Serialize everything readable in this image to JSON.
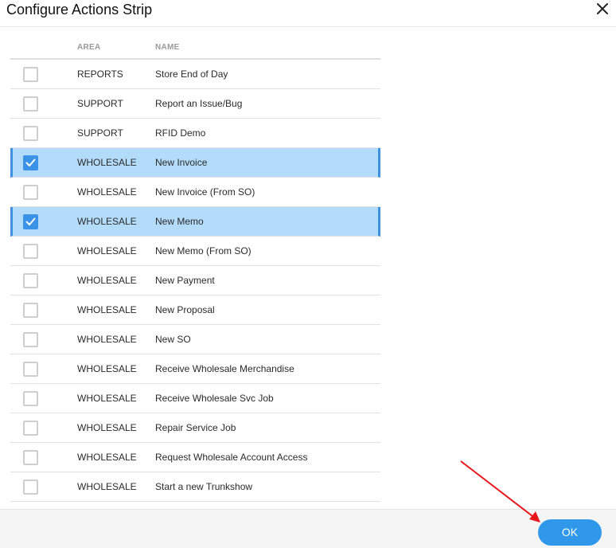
{
  "dialog": {
    "title": "Configure Actions Strip"
  },
  "table": {
    "headers": {
      "area": "AREA",
      "name": "NAME"
    },
    "rows": [
      {
        "area": "REPORTS",
        "name": "Store End of Day",
        "checked": false
      },
      {
        "area": "SUPPORT",
        "name": "Report an Issue/Bug",
        "checked": false
      },
      {
        "area": "SUPPORT",
        "name": "RFID Demo",
        "checked": false
      },
      {
        "area": "WHOLESALE",
        "name": "New Invoice",
        "checked": true
      },
      {
        "area": "WHOLESALE",
        "name": "New Invoice (From SO)",
        "checked": false
      },
      {
        "area": "WHOLESALE",
        "name": "New Memo",
        "checked": true
      },
      {
        "area": "WHOLESALE",
        "name": "New Memo (From SO)",
        "checked": false
      },
      {
        "area": "WHOLESALE",
        "name": "New Payment",
        "checked": false
      },
      {
        "area": "WHOLESALE",
        "name": "New Proposal",
        "checked": false
      },
      {
        "area": "WHOLESALE",
        "name": "New SO",
        "checked": false
      },
      {
        "area": "WHOLESALE",
        "name": "Receive Wholesale Merchandise",
        "checked": false
      },
      {
        "area": "WHOLESALE",
        "name": "Receive Wholesale Svc Job",
        "checked": false
      },
      {
        "area": "WHOLESALE",
        "name": "Repair Service Job",
        "checked": false
      },
      {
        "area": "WHOLESALE",
        "name": "Request Wholesale Account Access",
        "checked": false
      },
      {
        "area": "WHOLESALE",
        "name": "Start a new Trunkshow",
        "checked": false
      }
    ]
  },
  "footer": {
    "ok_label": "OK"
  },
  "colors": {
    "accent": "#2f98ea",
    "selected_row": "#b3dcfb",
    "annotation_arrow": "#e8161b"
  },
  "icons": {
    "close": "close-icon",
    "check": "checkmark-icon",
    "annotation": "red-arrow-annotation"
  }
}
